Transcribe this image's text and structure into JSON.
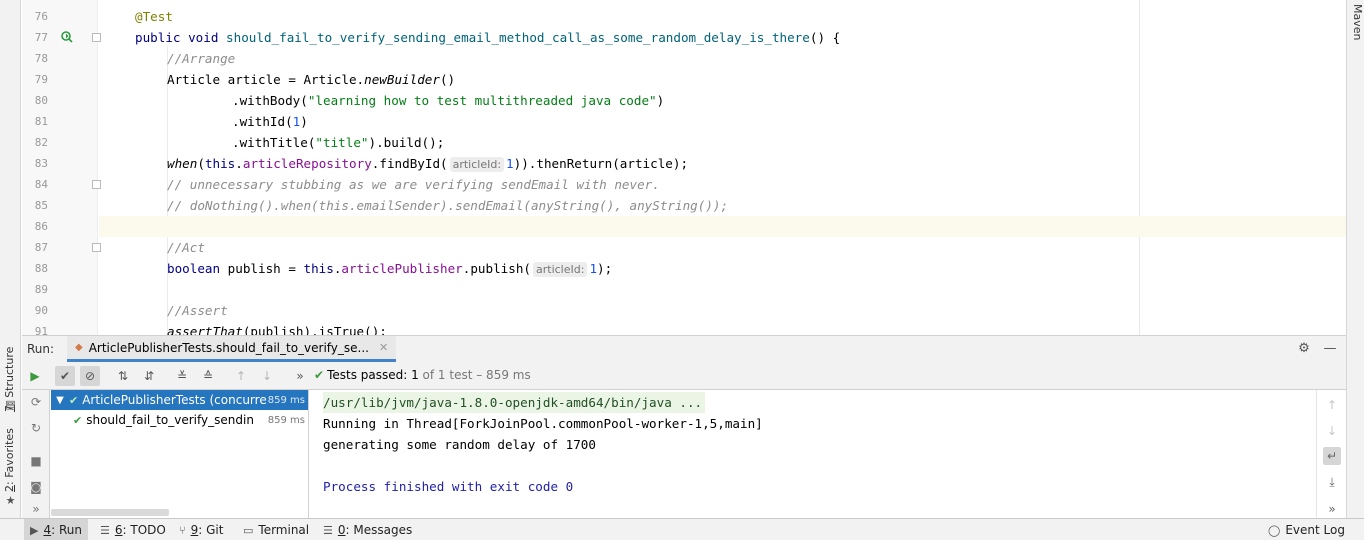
{
  "sidebar_left": {
    "structure_label_num": "7",
    "structure_label_text": ": Structure",
    "favorites_label_num": "2",
    "favorites_label_text": ": Favorites"
  },
  "sidebar_right": {
    "maven_label": "Maven"
  },
  "editor": {
    "lines": [
      {
        "n": "76"
      },
      {
        "n": "77"
      },
      {
        "n": "78"
      },
      {
        "n": "79"
      },
      {
        "n": "80"
      },
      {
        "n": "81"
      },
      {
        "n": "82"
      },
      {
        "n": "83"
      },
      {
        "n": "84"
      },
      {
        "n": "85"
      },
      {
        "n": "86"
      },
      {
        "n": "87"
      },
      {
        "n": "88"
      },
      {
        "n": "89"
      },
      {
        "n": "90"
      },
      {
        "n": "91"
      }
    ],
    "code": {
      "l76_ann": "@Test",
      "l77_kw1": "public",
      "l77_kw2": "void",
      "l77_name": "should_fail_to_verify_sending_email_method_call_as_some_random_delay_is_there",
      "l77_rest": "() {",
      "l78_cmt": "//Arrange",
      "l79_a": "Article article = Article.",
      "l79_b": "newBuilder",
      "l79_c": "()",
      "l80_a": ".withBody(",
      "l80_str": "\"learning how to test multithreaded java code\"",
      "l80_c": ")",
      "l81_a": ".withId(",
      "l81_num": "1",
      "l81_c": ")",
      "l82_a": ".withTitle(",
      "l82_str": "\"title\"",
      "l82_c": ").build();",
      "l83_when": "when",
      "l83_a": "(",
      "l83_this": "this",
      "l83_dot": ".",
      "l83_fld": "articleRepository",
      "l83_b": ".findById(",
      "l83_hint": "articleId:",
      "l83_num": "1",
      "l83_c": ")).thenReturn(article);",
      "l84_cmt": "// unnecessary stubbing as we are verifying sendEmail with never.",
      "l85_cmt": "// doNothing().when(this.emailSender).sendEmail(anyString(), anyString());",
      "l87_cmt": "//Act",
      "l88_kw": "boolean",
      "l88_a": " publish = ",
      "l88_this": "this",
      "l88_dot": ".",
      "l88_fld": "articlePublisher",
      "l88_b": ".publish(",
      "l88_hint": "articleId:",
      "l88_num": "1",
      "l88_c": ");",
      "l90_cmt": "//Assert",
      "l91_a": "assertThat",
      "l91_b": "(publish).isTrue();"
    }
  },
  "run_window": {
    "title": "Run:",
    "tab_label": "ArticlePublisherTests.should_fail_to_verify_se...",
    "status_passed": "Tests passed: ",
    "status_count": "1",
    "status_rest": " of 1 test – 859 ms",
    "tree": [
      {
        "name": "ArticlePublisherTests (concurre",
        "duration": "859 ms"
      },
      {
        "name": "should_fail_to_verify_sendin",
        "duration": "859 ms"
      }
    ],
    "console_lines": {
      "cmd": "/usr/lib/jvm/java-1.8.0-openjdk-amd64/bin/java ...",
      "line1": "Running in Thread[ForkJoinPool.commonPool-worker-1,5,main]",
      "line2": "generating some random delay of 1700",
      "line3": "Process finished with exit code 0"
    }
  },
  "bottom_bar": {
    "run_num": "4",
    "run_text": ": Run",
    "todo_num": "6",
    "todo_text": ": TODO",
    "git_num": "9",
    "git_text": ": Git",
    "terminal": "Terminal",
    "messages_num": "0",
    "messages_text": ": Messages",
    "event_log": "Event Log"
  },
  "colors": {
    "accent": "#4083c9",
    "selection": "#2675bf",
    "pass_green": "#3c9a3c"
  }
}
